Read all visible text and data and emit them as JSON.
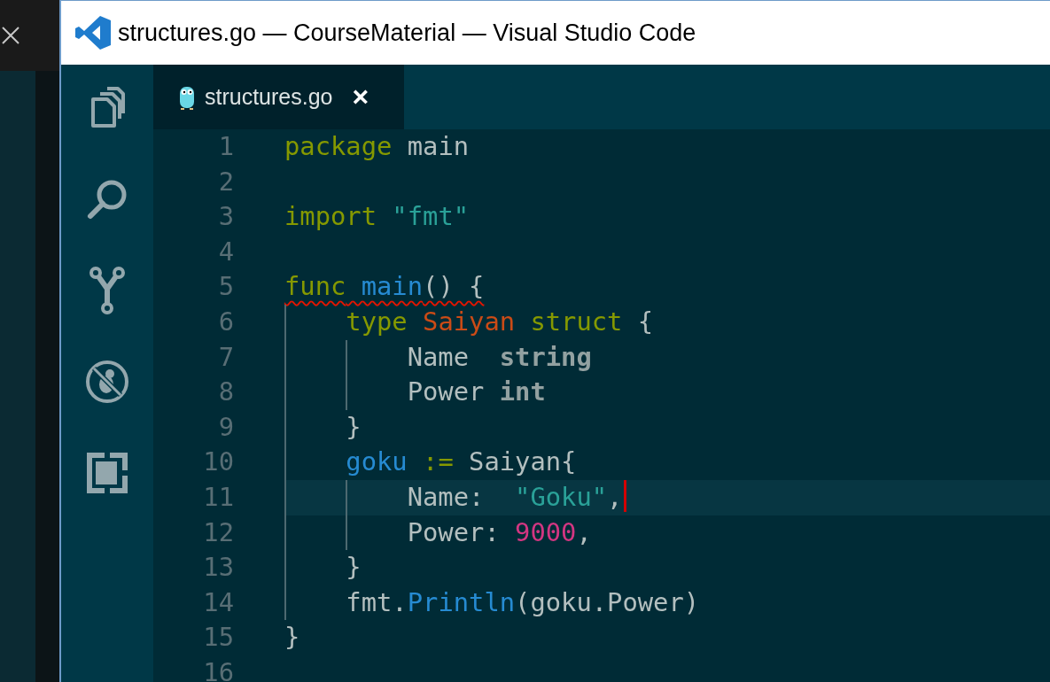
{
  "window": {
    "title": "structures.go — CourseMaterial — Visual Studio Code"
  },
  "activity_bar": {
    "items": [
      {
        "kind": "files"
      },
      {
        "kind": "search"
      },
      {
        "kind": "git"
      },
      {
        "kind": "debug"
      },
      {
        "kind": "extensions"
      }
    ]
  },
  "tabs": [
    {
      "label": "structures.go",
      "close": "×",
      "selected": true
    }
  ],
  "editor": {
    "lines": [
      {
        "number": "1",
        "tokens": [
          {
            "kind": "keyword",
            "text": "package"
          },
          {
            "kind": "plain",
            "text": " main"
          }
        ]
      },
      {
        "number": "2"
      },
      {
        "number": "3",
        "tokens": [
          {
            "kind": "keyword",
            "text": "import"
          },
          {
            "kind": "string",
            "text": " \"fmt\""
          }
        ]
      },
      {
        "number": "4"
      },
      {
        "number": "5",
        "error": true,
        "tokens": [
          {
            "kind": "keyword",
            "text": "func"
          },
          {
            "kind": "function",
            "text": " main"
          },
          {
            "kind": "plain",
            "text": "() {"
          }
        ]
      },
      {
        "number": "6",
        "tokens": [
          {
            "kind": "keyword",
            "text": "    type"
          },
          {
            "kind": "typename",
            "text": " Saiyan"
          },
          {
            "kind": "keyword",
            "text": " struct"
          },
          {
            "kind": "plain",
            "text": " {"
          }
        ]
      },
      {
        "number": "7",
        "tokens": [
          {
            "kind": "plain",
            "text": "        Name  "
          },
          {
            "kind": "builtin",
            "text": "string"
          }
        ]
      },
      {
        "number": "8",
        "tokens": [
          {
            "kind": "plain",
            "text": "        Power "
          },
          {
            "kind": "builtin",
            "text": "int"
          }
        ]
      },
      {
        "number": "9",
        "tokens": [
          {
            "kind": "plain",
            "text": "    }"
          }
        ]
      },
      {
        "number": "10",
        "tokens": [
          {
            "kind": "function",
            "text": "    goku"
          },
          {
            "kind": "keyword",
            "text": " :="
          },
          {
            "kind": "plain",
            "text": " Saiyan{"
          }
        ]
      },
      {
        "number": "11",
        "current": true,
        "cursor": true,
        "tokens": [
          {
            "kind": "plain",
            "text": "        Name:  "
          },
          {
            "kind": "string",
            "text": "\"Goku\""
          },
          {
            "kind": "plain",
            "text": ","
          }
        ]
      },
      {
        "number": "12",
        "tokens": [
          {
            "kind": "plain",
            "text": "        Power: "
          },
          {
            "kind": "number",
            "text": "9000"
          },
          {
            "kind": "plain",
            "text": ","
          }
        ]
      },
      {
        "number": "13",
        "tokens": [
          {
            "kind": "plain",
            "text": "    }"
          }
        ]
      },
      {
        "number": "14",
        "tokens": [
          {
            "kind": "plain",
            "text": "    fmt."
          },
          {
            "kind": "function",
            "text": "Println"
          },
          {
            "kind": "plain",
            "text": "(goku.Power)"
          }
        ]
      },
      {
        "number": "15",
        "tokens": [
          {
            "kind": "plain",
            "text": "}"
          }
        ]
      },
      {
        "number": "16"
      }
    ]
  }
}
